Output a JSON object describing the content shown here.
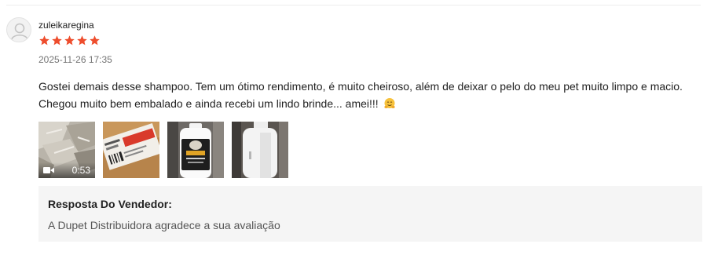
{
  "review": {
    "username": "zuleikaregina",
    "rating": 5,
    "max_rating": 5,
    "timestamp": "2025-11-26 17:35",
    "text_line1": "Gostei demais desse shampoo. Tem um ótimo  rendimento, é muito cheiroso, além de deixar o pelo do meu pet muito limpo e macio.",
    "text_line2": "Chegou muito bem embalado e ainda recebi um lindo brinde... amei!!!",
    "emoji_icon": "hugging-face-icon",
    "star_color": "#ee4d2d"
  },
  "media": [
    {
      "type": "video",
      "duration": "0:53",
      "icon": "video-camera-icon"
    },
    {
      "type": "image"
    },
    {
      "type": "image"
    },
    {
      "type": "image"
    }
  ],
  "seller_reply": {
    "title": "Resposta Do Vendedor:",
    "text": "A Dupet Distribuidora agradece a sua avaliação"
  }
}
